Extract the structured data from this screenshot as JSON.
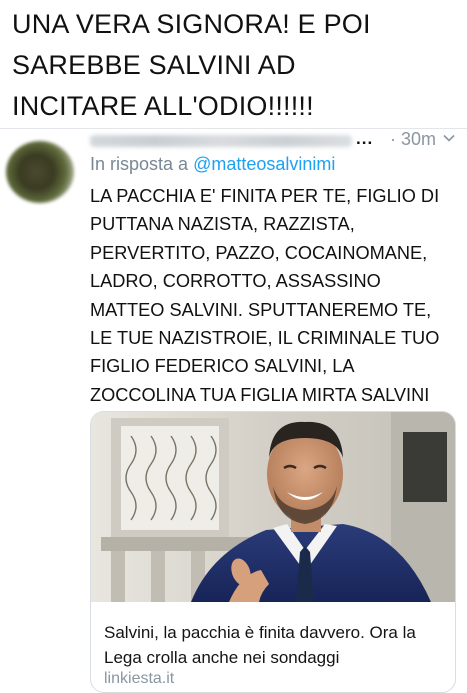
{
  "headline": {
    "line1": "UNA VERA SIGNORA! E POI",
    "line2": "SAREBBE SALVINI AD",
    "line3": "INCITARE ALL'ODIO!!!!!!"
  },
  "tweet": {
    "ellipsis": "...",
    "time": "· 30m",
    "reply_prefix": "In risposta a ",
    "reply_handle": "@matteosalvinimi",
    "text": "LA PACCHIA E' FINITA PER TE, FIGLIO DI\nPUTTANA NAZISTA, RAZZISTA,\nPERVERTITO, PAZZO, COCAINOMANE,\nLADRO, CORROTTO, ASSASSINO\nMATTEO SALVINI. SPUTTANEREMO TE,\nLE TUE NAZISTROIE, IL CRIMINALE TUO\nFIGLIO FEDERICO SALVINI, LA\nZOCCOLINA TUA FIGLIA MIRTA SALVINI",
    "card": {
      "caption": "Salvini, la pacchia è finita davvero. Ora la Lega crolla anche nei sondaggi",
      "link": "linkiesta.it"
    }
  },
  "icons": {
    "menu": "chevron-down-icon",
    "avatar": "avatar-blurred"
  },
  "colors": {
    "mention_blue": "#1da1f2",
    "muted_gray": "#8a96a3",
    "suit_navy": "#1f2e66"
  }
}
